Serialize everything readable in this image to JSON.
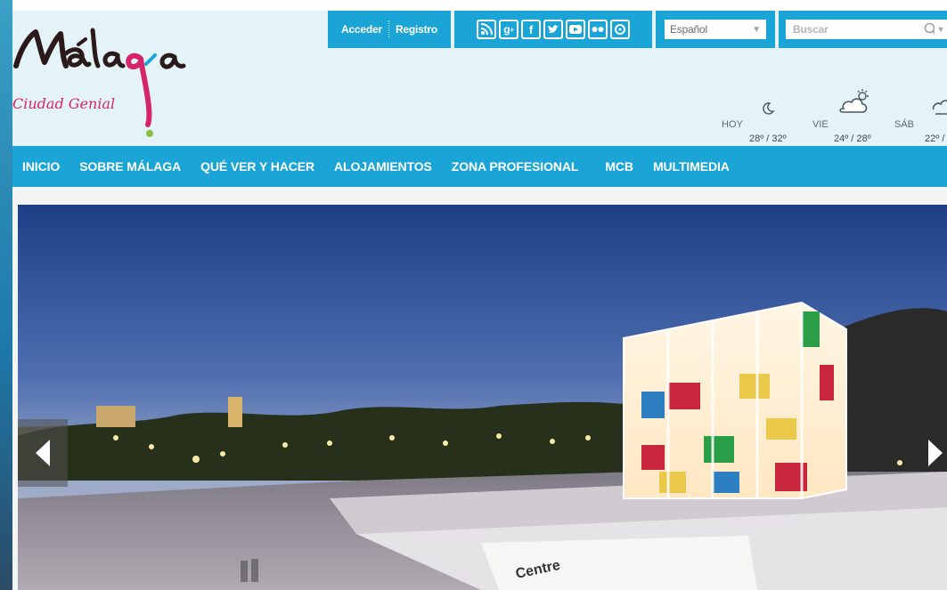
{
  "logo": {
    "title": "Málaga",
    "subtitle": "Ciudad Genial"
  },
  "auth": {
    "login": "Acceder",
    "register": "Registro"
  },
  "social": [
    "rss-icon",
    "google-plus-icon",
    "facebook-icon",
    "twitter-icon",
    "youtube-icon",
    "flickr-icon",
    "foursquare-icon"
  ],
  "language": {
    "selected": "Español"
  },
  "search": {
    "placeholder": "Buscar"
  },
  "weather": {
    "today_label": "HOY",
    "today_temp": "28º / 32º",
    "day2_label": "VIE",
    "day2_temp": "24º / 28º",
    "day3_label": "SÁB",
    "day3_temp": "22º /"
  },
  "nav": [
    "INICIO",
    "SOBRE MÁLAGA",
    "QUÉ VER Y HACER",
    "ALOJAMIENTOS",
    "ZONA PROFESIONAL",
    "MCB",
    "MULTIMEDIA"
  ],
  "hero": {
    "caption": "Centre"
  },
  "colors": {
    "brand": "#1ba5d6",
    "header_bg": "#e4f3f8",
    "logo_pink": "#d4256b",
    "logo_teal": "#1ba5d6"
  }
}
